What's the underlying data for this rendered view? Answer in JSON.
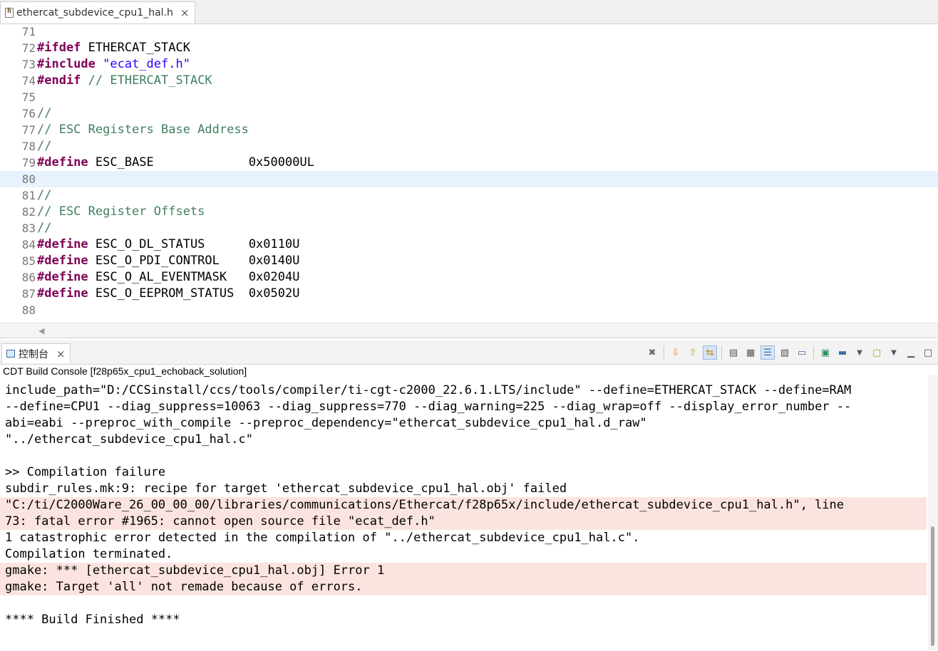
{
  "editor": {
    "tab_label": "ethercat_subdevice_cpu1_hal.h",
    "tab_close": "×",
    "lines": [
      {
        "n": "71",
        "parts": []
      },
      {
        "n": "72",
        "parts": [
          [
            "kw",
            "#ifdef"
          ],
          [
            "plain",
            " ETHERCAT_STACK"
          ]
        ]
      },
      {
        "n": "73",
        "parts": [
          [
            "kw",
            "#include"
          ],
          [
            "plain",
            " "
          ],
          [
            "str",
            "\"ecat_def.h\""
          ]
        ]
      },
      {
        "n": "74",
        "parts": [
          [
            "kw",
            "#endif"
          ],
          [
            "plain",
            " "
          ],
          [
            "cmt",
            "// ETHERCAT_STACK"
          ]
        ]
      },
      {
        "n": "75",
        "parts": []
      },
      {
        "n": "76",
        "parts": [
          [
            "cmt",
            "//"
          ]
        ]
      },
      {
        "n": "77",
        "parts": [
          [
            "cmt",
            "// ESC Registers Base Address"
          ]
        ]
      },
      {
        "n": "78",
        "parts": [
          [
            "cmt",
            "//"
          ]
        ]
      },
      {
        "n": "79",
        "parts": [
          [
            "kw",
            "#define"
          ],
          [
            "plain",
            " ESC_BASE             0x50000UL"
          ]
        ]
      },
      {
        "n": "80",
        "parts": [],
        "current": true
      },
      {
        "n": "81",
        "parts": [
          [
            "cmt",
            "//"
          ]
        ]
      },
      {
        "n": "82",
        "parts": [
          [
            "cmt",
            "// ESC Register Offsets"
          ]
        ]
      },
      {
        "n": "83",
        "parts": [
          [
            "cmt",
            "//"
          ]
        ]
      },
      {
        "n": "84",
        "parts": [
          [
            "kw",
            "#define"
          ],
          [
            "plain",
            " ESC_O_DL_STATUS      0x0110U"
          ]
        ]
      },
      {
        "n": "85",
        "parts": [
          [
            "kw",
            "#define"
          ],
          [
            "plain",
            " ESC_O_PDI_CONTROL    0x0140U"
          ]
        ]
      },
      {
        "n": "86",
        "parts": [
          [
            "kw",
            "#define"
          ],
          [
            "plain",
            " ESC_O_AL_EVENTMASK   0x0204U"
          ]
        ]
      },
      {
        "n": "87",
        "parts": [
          [
            "kw",
            "#define"
          ],
          [
            "plain",
            " ESC_O_EEPROM_STATUS  0x0502U"
          ]
        ]
      },
      {
        "n": "88",
        "parts": []
      }
    ]
  },
  "console": {
    "tab_label": "控制台",
    "tab_close": "×",
    "title": "CDT Build Console [f28p65x_cpu1_echoback_solution]",
    "toolbar_icons": [
      "clear-console-icon",
      "next-error-icon",
      "previous-error-icon",
      "scroll-lock-icon",
      "word-wrap-icon",
      "show-on-output-icon",
      "pin-console-icon",
      "console-options-icon",
      "display-console-icon",
      "open-console-icon",
      "minimize-icon",
      "maximize-icon"
    ],
    "lines": [
      {
        "text": "include_path=\"D:/CCSinstall/ccs/tools/compiler/ti-cgt-c2000_22.6.1.LTS/include\" --define=ETHERCAT_STACK --define=RAM",
        "err": false
      },
      {
        "text": "--define=CPU1 --diag_suppress=10063 --diag_suppress=770 --diag_warning=225 --diag_wrap=off --display_error_number --",
        "err": false
      },
      {
        "text": "abi=eabi --preproc_with_compile --preproc_dependency=\"ethercat_subdevice_cpu1_hal.d_raw\"",
        "err": false
      },
      {
        "text": "\"../ethercat_subdevice_cpu1_hal.c\"",
        "err": false
      },
      {
        "text": "",
        "err": false
      },
      {
        "text": ">> Compilation failure",
        "err": false
      },
      {
        "text": "subdir_rules.mk:9: recipe for target 'ethercat_subdevice_cpu1_hal.obj' failed",
        "err": false
      },
      {
        "text": "\"C:/ti/C2000Ware_26_00_00_00/libraries/communications/Ethercat/f28p65x/include/ethercat_subdevice_cpu1_hal.h\", line",
        "err": true
      },
      {
        "text": "73: fatal error #1965: cannot open source file \"ecat_def.h\"",
        "err": true
      },
      {
        "text": "1 catastrophic error detected in the compilation of \"../ethercat_subdevice_cpu1_hal.c\".",
        "err": false
      },
      {
        "text": "Compilation terminated.",
        "err": false
      },
      {
        "text": "gmake: *** [ethercat_subdevice_cpu1_hal.obj] Error 1",
        "err": true
      },
      {
        "text": "gmake: Target 'all' not remade because of errors.",
        "err": true
      },
      {
        "text": "",
        "err": false
      },
      {
        "text": "**** Build Finished ****",
        "err": false
      }
    ]
  }
}
